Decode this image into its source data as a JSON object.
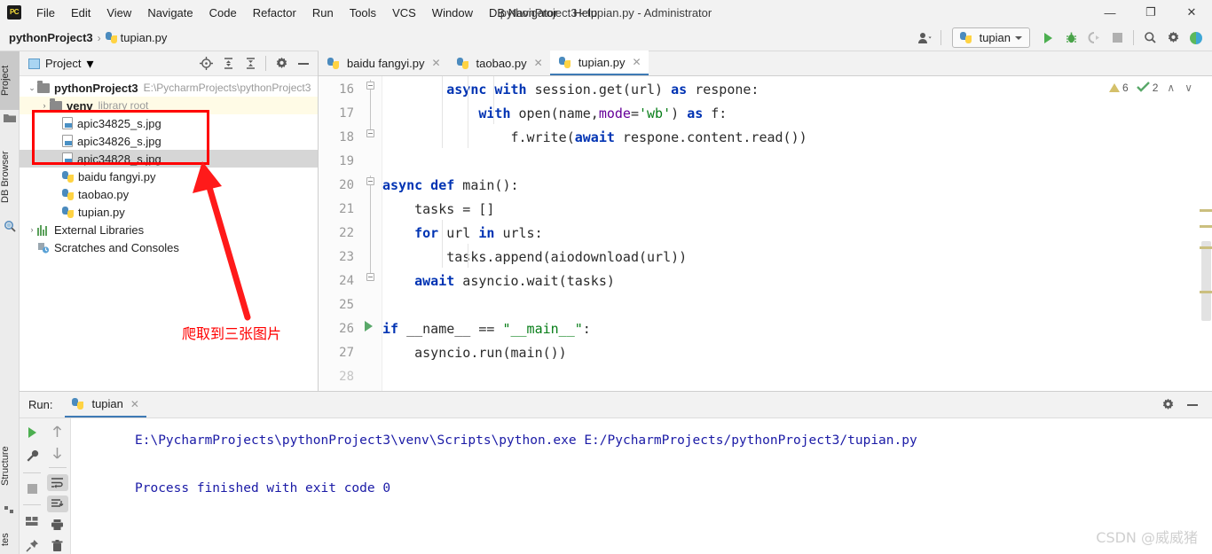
{
  "window": {
    "title": "pythonProject3 - tupian.py - Administrator",
    "logo_text": "PC",
    "minimize": "—",
    "maximize": "❐",
    "close": "✕"
  },
  "menubar": {
    "items": [
      {
        "label": "File"
      },
      {
        "label": "Edit"
      },
      {
        "label": "View"
      },
      {
        "label": "Navigate"
      },
      {
        "label": "Code"
      },
      {
        "label": "Refactor"
      },
      {
        "label": "Run"
      },
      {
        "label": "Tools"
      },
      {
        "label": "VCS"
      },
      {
        "label": "Window"
      },
      {
        "label": "DB Navigator"
      },
      {
        "label": "Help"
      }
    ]
  },
  "breadcrumb": {
    "project": "pythonProject3",
    "separator": "›",
    "file": "tupian.py"
  },
  "toolbar": {
    "account_icon": "account-icon",
    "run_config": "tupian",
    "run_icon": "run-icon",
    "debug_icon": "debug-icon",
    "coverage_icon": "run-with-coverage-icon",
    "stop_icon": "stop-icon",
    "search_icon": "search-everywhere-icon",
    "settings_icon": "settings-icon",
    "updates_icon": "updates-icon"
  },
  "left_strip": {
    "tabs": [
      {
        "label": "Project",
        "icon": "project-folder-icon",
        "active": true
      },
      {
        "label": "DB Browser",
        "icon": "db-browser-icon",
        "active": false
      }
    ],
    "bottom_tabs": [
      {
        "label": "Structure",
        "icon": "structure-icon"
      },
      {
        "label": "tes",
        "icon": "favorites-icon"
      }
    ]
  },
  "project_panel": {
    "title": "Project",
    "dropdown": "▾",
    "icons": [
      "locate-icon",
      "expand-all-icon",
      "collapse-all-icon",
      "gear-icon",
      "hide-icon"
    ],
    "tree": [
      {
        "label": "pythonProject3",
        "detail": "E:\\PycharmProjects\\pythonProject3",
        "icon": "folder-icon",
        "arrow": "⌄",
        "depth": 0,
        "bold": true,
        "highlight": "none"
      },
      {
        "label": "venv",
        "detail": "library root",
        "icon": "folder-icon",
        "arrow": "›",
        "depth": 1,
        "bold": true,
        "highlight": "yellow"
      },
      {
        "label": "apic34825_s.jpg",
        "detail": "",
        "icon": "image-file-icon",
        "arrow": "",
        "depth": 2,
        "bold": false,
        "highlight": "none"
      },
      {
        "label": "apic34826_s.jpg",
        "detail": "",
        "icon": "image-file-icon",
        "arrow": "",
        "depth": 2,
        "bold": false,
        "highlight": "none"
      },
      {
        "label": "apic34828_s.jpg",
        "detail": "",
        "icon": "image-file-icon",
        "arrow": "",
        "depth": 2,
        "bold": false,
        "highlight": "gray"
      },
      {
        "label": "baidu fangyi.py",
        "detail": "",
        "icon": "python-file-icon",
        "arrow": "",
        "depth": 2,
        "bold": false,
        "highlight": "none"
      },
      {
        "label": "taobao.py",
        "detail": "",
        "icon": "python-file-icon",
        "arrow": "",
        "depth": 2,
        "bold": false,
        "highlight": "none"
      },
      {
        "label": "tupian.py",
        "detail": "",
        "icon": "python-file-icon",
        "arrow": "",
        "depth": 2,
        "bold": false,
        "highlight": "none"
      },
      {
        "label": "External Libraries",
        "detail": "",
        "icon": "libraries-icon",
        "arrow": "›",
        "depth": 0,
        "bold": false,
        "highlight": "none"
      },
      {
        "label": "Scratches and Consoles",
        "detail": "",
        "icon": "scratches-icon",
        "arrow": "",
        "depth": 0,
        "bold": false,
        "highlight": "none"
      }
    ]
  },
  "annotation": {
    "note_text": "爬取到三张图片",
    "color": "#ff0000"
  },
  "editor": {
    "tabs": [
      {
        "label": "baidu fangyi.py",
        "active": false,
        "close": "✕"
      },
      {
        "label": "taobao.py",
        "active": false,
        "close": "✕"
      },
      {
        "label": "tupian.py",
        "active": true,
        "close": "✕"
      }
    ],
    "status": {
      "warning_count": "6",
      "weak_warning_count": "2",
      "prev_icon": "∧",
      "next_icon": "∨"
    },
    "lines": [
      {
        "num": "16",
        "text": "        async with session.get(url) as respone:"
      },
      {
        "num": "17",
        "text": "            with open(name,mode='wb') as f:"
      },
      {
        "num": "18",
        "text": "                f.write(await respone.content.read())"
      },
      {
        "num": "19",
        "text": ""
      },
      {
        "num": "20",
        "text": "async def main():"
      },
      {
        "num": "21",
        "text": "    tasks = []"
      },
      {
        "num": "22",
        "text": "    for url in urls:"
      },
      {
        "num": "23",
        "text": "        tasks.append(aiodownload(url))"
      },
      {
        "num": "24",
        "text": "    await asyncio.wait(tasks)"
      },
      {
        "num": "25",
        "text": ""
      },
      {
        "num": "26",
        "text": "if __name__ == \"__main__\":"
      },
      {
        "num": "27",
        "text": "    asyncio.run(main())"
      },
      {
        "num": "28",
        "text": ""
      }
    ]
  },
  "run_panel": {
    "label": "Run:",
    "tab": "tupian",
    "tab_close": "✕",
    "head_icons": [
      "gear-icon",
      "hide-icon"
    ],
    "tool_icons": [
      "rerun-icon",
      "settings-wrench-icon",
      "stop-icon",
      "layout-icon",
      "pin-icon",
      "up-arrow-icon",
      "down-arrow-icon",
      "soft-wrap-icon",
      "scroll-to-end-icon",
      "print-icon",
      "trash-icon"
    ],
    "console_lines": [
      "E:\\PycharmProjects\\pythonProject3\\venv\\Scripts\\python.exe E:/PycharmProjects/pythonProject3/tupian.py",
      "",
      "Process finished with exit code 0"
    ]
  },
  "watermark": "CSDN @威威猪"
}
